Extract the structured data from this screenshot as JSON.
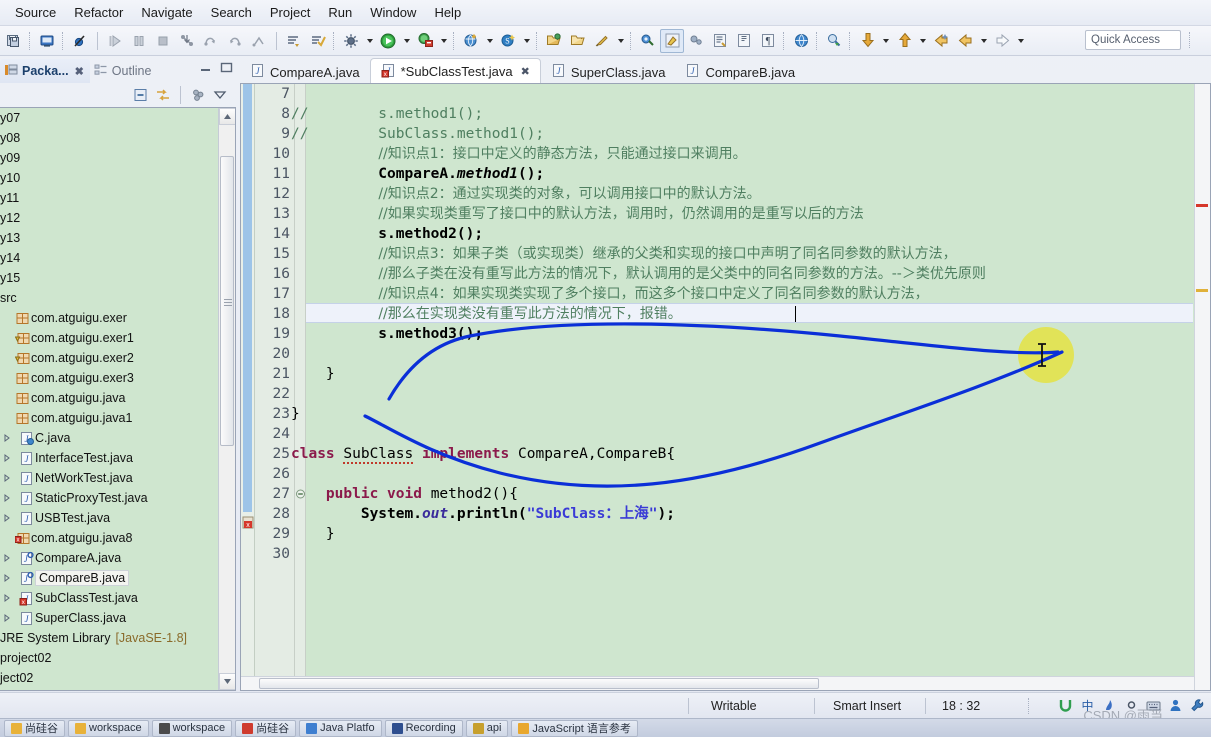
{
  "menubar": {
    "items": [
      "Source",
      "Refactor",
      "Navigate",
      "Search",
      "Project",
      "Run",
      "Window",
      "Help"
    ]
  },
  "toolbar": {
    "quick_access_placeholder": "Quick Access",
    "buttons": [
      {
        "name": "save-all",
        "glyph": "❐"
      },
      {
        "name": "new-java-class",
        "glyph": "▣"
      },
      {
        "name": "skip-all-breakpoints",
        "glyph": "⊘"
      },
      {
        "name": "resume",
        "glyph": "▶"
      },
      {
        "name": "suspend",
        "glyph": "⏸"
      },
      {
        "name": "terminate",
        "glyph": "■"
      },
      {
        "name": "step-into",
        "glyph": "⤵"
      },
      {
        "name": "step-over",
        "glyph": "↷"
      },
      {
        "name": "step-return",
        "glyph": "↰"
      },
      {
        "name": "drop-to-frame",
        "glyph": "↩"
      },
      {
        "name": "open-task",
        "glyph": "☰"
      },
      {
        "name": "new-task",
        "glyph": "✔"
      },
      {
        "name": "debug",
        "glyph": "☀"
      },
      {
        "name": "run",
        "glyph": "▶"
      },
      {
        "name": "run-external-tools",
        "glyph": "⚙"
      },
      {
        "name": "new-java-project",
        "glyph": "◳"
      },
      {
        "name": "new-package",
        "glyph": "Ⓢ"
      },
      {
        "name": "open-type",
        "glyph": "⚱"
      },
      {
        "name": "open-resource",
        "glyph": "▱"
      },
      {
        "name": "search",
        "glyph": "✎"
      },
      {
        "name": "next-annotation",
        "glyph": "⚐"
      },
      {
        "name": "previous-annotation",
        "glyph": "⚑"
      },
      {
        "name": "toggle-mark-occurrences",
        "glyph": "❖"
      },
      {
        "name": "open-task-repository",
        "glyph": "≣"
      },
      {
        "name": "toggle-block-selection",
        "glyph": "¶"
      },
      {
        "name": "open-web-browser",
        "glyph": "◉"
      },
      {
        "name": "search-references",
        "glyph": "⌖"
      },
      {
        "name": "previous-edit-location",
        "glyph": "⇩"
      },
      {
        "name": "next-edit-location",
        "glyph": "⇧"
      },
      {
        "name": "back",
        "glyph": "←"
      },
      {
        "name": "back-history",
        "glyph": "←"
      },
      {
        "name": "forward",
        "glyph": "→"
      }
    ]
  },
  "left_view": {
    "tabs": [
      {
        "label": "Packa...",
        "active": true,
        "closeable": true
      },
      {
        "label": "Outline",
        "active": false,
        "closeable": false
      }
    ],
    "window_buttons": [
      "minimize",
      "maximize"
    ],
    "view_toolbar": [
      "collapse-all-icon",
      "link-with-editor-icon",
      "view-menu-filters-icon",
      "view-menu-icon"
    ],
    "tree": [
      {
        "label": "y07",
        "icon": "none",
        "indent": 0,
        "clipped": true,
        "twist": false
      },
      {
        "label": "y08",
        "icon": "none",
        "indent": 0,
        "clipped": true,
        "twist": false
      },
      {
        "label": "y09",
        "icon": "none",
        "indent": 0,
        "clipped": true,
        "twist": false
      },
      {
        "label": "y10",
        "icon": "none",
        "indent": 0,
        "clipped": true,
        "twist": false
      },
      {
        "label": "y11",
        "icon": "none",
        "indent": 0,
        "clipped": true,
        "twist": false
      },
      {
        "label": "y12",
        "icon": "none",
        "indent": 0,
        "clipped": true,
        "twist": false
      },
      {
        "label": "y13",
        "icon": "none",
        "indent": 0,
        "clipped": true,
        "twist": false
      },
      {
        "label": "y14",
        "icon": "none",
        "indent": 0,
        "clipped": true,
        "twist": false
      },
      {
        "label": "y15",
        "icon": "none",
        "indent": 0,
        "clipped": true,
        "twist": false
      },
      {
        "label": "src",
        "icon": "none",
        "indent": 0,
        "clipped": true,
        "twist": false
      },
      {
        "label": "com.atguigu.exer",
        "icon": "package-icon",
        "indent": 1,
        "twist": false
      },
      {
        "label": "com.atguigu.exer1",
        "icon": "package-warning-icon",
        "indent": 1,
        "twist": false
      },
      {
        "label": "com.atguigu.exer2",
        "icon": "package-warning-icon",
        "indent": 1,
        "twist": false
      },
      {
        "label": "com.atguigu.exer3",
        "icon": "package-icon",
        "indent": 1,
        "twist": false
      },
      {
        "label": "com.atguigu.java",
        "icon": "package-icon",
        "indent": 1,
        "twist": false
      },
      {
        "label": "com.atguigu.java1",
        "icon": "package-icon",
        "indent": 1,
        "twist": false
      },
      {
        "label": "C.java",
        "icon": "java-class-icon",
        "indent": 2,
        "twist": true
      },
      {
        "label": "InterfaceTest.java",
        "icon": "java-file-icon",
        "indent": 2,
        "twist": true
      },
      {
        "label": "NetWorkTest.java",
        "icon": "java-file-icon",
        "indent": 2,
        "twist": true
      },
      {
        "label": "StaticProxyTest.java",
        "icon": "java-file-icon",
        "indent": 2,
        "twist": true
      },
      {
        "label": "USBTest.java",
        "icon": "java-file-icon",
        "indent": 2,
        "twist": true
      },
      {
        "label": "com.atguigu.java8",
        "icon": "package-error-icon",
        "indent": 1,
        "twist": false
      },
      {
        "label": "CompareA.java",
        "icon": "java-interface-icon",
        "indent": 2,
        "twist": true
      },
      {
        "label": "CompareB.java",
        "icon": "java-interface-icon",
        "indent": 2,
        "twist": true,
        "selected": true
      },
      {
        "label": "SubClassTest.java",
        "icon": "java-error-icon",
        "indent": 2,
        "twist": true
      },
      {
        "label": "SuperClass.java",
        "icon": "java-file-icon",
        "indent": 2,
        "twist": true
      },
      {
        "label": "JRE System Library",
        "version": "[JavaSE-1.8]",
        "icon": "none",
        "indent": 0,
        "clipped": true,
        "twist": false
      },
      {
        "label": "project02",
        "icon": "none",
        "indent": 0,
        "clipped": true,
        "twist": false
      },
      {
        "label": "ject02",
        "icon": "none",
        "indent": 0,
        "clipped": true,
        "twist": false
      }
    ]
  },
  "editor": {
    "tabs": [
      {
        "label": "CompareA.java",
        "icon": "java-file-icon",
        "active": false,
        "dirty": false
      },
      {
        "label": "*SubClassTest.java",
        "icon": "java-error-icon",
        "active": true,
        "dirty": true
      },
      {
        "label": "SuperClass.java",
        "icon": "java-file-icon",
        "active": false,
        "dirty": false
      },
      {
        "label": "CompareB.java",
        "icon": "java-file-icon",
        "active": false,
        "dirty": false
      }
    ],
    "first_visible_line": 7,
    "current_line": 18,
    "lines": [
      {
        "n": 7,
        "text": ""
      },
      {
        "n": 8,
        "text": "//        s.method1();"
      },
      {
        "n": 9,
        "text": "//        SubClass.method1();"
      },
      {
        "n": 10,
        "text": "          //知识点1：接口中定义的静态方法，只能通过接口来调用。"
      },
      {
        "n": 11,
        "text": "          CompareA.method1();"
      },
      {
        "n": 12,
        "text": "          //知识点2：通过实现类的对象，可以调用接口中的默认方法。"
      },
      {
        "n": 13,
        "text": "          //如果实现类重写了接口中的默认方法，调用时，仍然调用的是重写以后的方法"
      },
      {
        "n": 14,
        "text": "          s.method2();"
      },
      {
        "n": 15,
        "text": "          //知识点3：如果子类（或实现类）继承的父类和实现的接口中声明了同名同参数的默认方法，"
      },
      {
        "n": 16,
        "text": "          //那么子类在没有重写此方法的情况下，默认调用的是父类中的同名同参数的方法。--＞类优先原则"
      },
      {
        "n": 17,
        "text": "          //知识点4：如果实现类实现了多个接口，而这多个接口中定义了同名同参数的默认方法，"
      },
      {
        "n": 18,
        "text": "          //那么在实现类没有重写此方法的情况下，报错。"
      },
      {
        "n": 19,
        "text": "          s.method3();"
      },
      {
        "n": 20,
        "text": ""
      },
      {
        "n": 21,
        "text": "    }"
      },
      {
        "n": 22,
        "text": ""
      },
      {
        "n": 23,
        "text": "}"
      },
      {
        "n": 24,
        "text": ""
      },
      {
        "n": 25,
        "text": "class SubClass implements CompareA,CompareB{"
      },
      {
        "n": 26,
        "text": ""
      },
      {
        "n": 27,
        "text": "    public void method2(){"
      },
      {
        "n": 28,
        "text": "        System.out.println(\"SubClass：上海\");"
      },
      {
        "n": 29,
        "text": "    }"
      },
      {
        "n": 30,
        "text": ""
      }
    ]
  },
  "statusbar": {
    "writable": "Writable",
    "insert_mode": "Smart Insert",
    "position": "18 : 32",
    "watermark": "CSDN @雨当",
    "tray_icons": [
      "sogou-ime-icon",
      "chinese-mode-icon",
      "pen-icon",
      "circle-icon",
      "keyboard-icon",
      "user-icon",
      "wrench-icon"
    ]
  },
  "taskbar": {
    "items": [
      {
        "label": "尚硅谷",
        "color": "#e8b23a"
      },
      {
        "label": "workspace",
        "color": "#e8b23a"
      },
      {
        "label": "workspace",
        "color": "#4b4b4b"
      },
      {
        "label": "尚硅谷",
        "color": "#cf3b2e"
      },
      {
        "label": "Java Platfo",
        "color": "#3f7fd0"
      },
      {
        "label": "Recording",
        "color": "#2f4f8f"
      },
      {
        "label": "api",
        "color": "#c7a02e"
      },
      {
        "label": "JavaScript 语言参考",
        "color": "#e8a72e"
      }
    ]
  },
  "colors": {
    "editor_bg": "#cfe6cf",
    "tree_bg": "#cfe6cf",
    "comment": "#4f7f60",
    "keyword": "#8b1a4b",
    "string": "#3a3ad6",
    "annotation_blue": "#0b2fd8",
    "highlight_yellow": "#e8e22a"
  }
}
